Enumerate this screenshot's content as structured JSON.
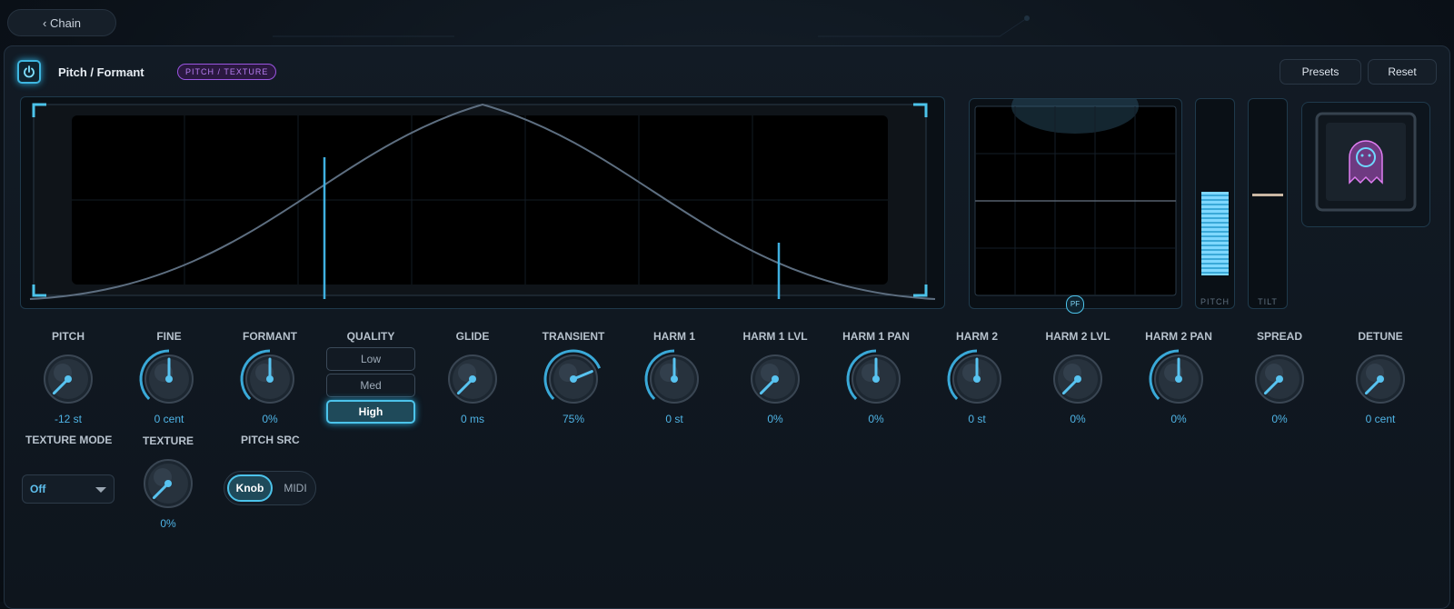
{
  "nav": {
    "back_label": "‹ Chain"
  },
  "module": {
    "title": "Pitch / Formant",
    "category": "PITCH / TEXTURE",
    "presets_label": "Presets",
    "reset_label": "Reset"
  },
  "display": {
    "pad_badge": "PF",
    "pitch_meter_label": "PITCH",
    "pitch_meter_level": 0.42,
    "tilt_meter_label": "TILT",
    "tilt_meter_position": 0.5
  },
  "controls_row1": [
    {
      "id": "pitch",
      "label": "PITCH",
      "value": "-12 st",
      "norm": 0.0
    },
    {
      "id": "fine",
      "label": "FINE",
      "value": "0 cent",
      "norm": 0.5
    },
    {
      "id": "formant",
      "label": "FORMANT",
      "value": "0%",
      "norm": 0.5
    },
    {
      "id": "glide",
      "label": "GLIDE",
      "value": "0 ms",
      "norm": 0.0
    },
    {
      "id": "transient",
      "label": "TRANSIENT",
      "value": "75%",
      "norm": 0.75
    },
    {
      "id": "harm1",
      "label": "HARM 1",
      "value": "0 st",
      "norm": 0.5
    },
    {
      "id": "harm1lvl",
      "label": "HARM 1 LVL",
      "value": "0%",
      "norm": 0.0
    },
    {
      "id": "harm1pan",
      "label": "HARM 1 PAN",
      "value": "0%",
      "norm": 0.5
    },
    {
      "id": "harm2",
      "label": "HARM 2",
      "value": "0 st",
      "norm": 0.5
    },
    {
      "id": "harm2lvl",
      "label": "HARM 2 LVL",
      "value": "0%",
      "norm": 0.0
    },
    {
      "id": "harm2pan",
      "label": "HARM 2 PAN",
      "value": "0%",
      "norm": 0.5
    },
    {
      "id": "spread",
      "label": "SPREAD",
      "value": "0%",
      "norm": 0.0
    },
    {
      "id": "detune",
      "label": "DETUNE",
      "value": "0 cent",
      "norm": 0.0
    }
  ],
  "quality": {
    "label": "QUALITY",
    "options": [
      "Low",
      "Med",
      "High"
    ],
    "selected": "High"
  },
  "texture_mode": {
    "label": "TEXTURE MODE",
    "value": "Off"
  },
  "texture": {
    "label": "TEXTURE",
    "value": "0%",
    "norm": 0.0
  },
  "pitch_src": {
    "label": "PITCH SRC",
    "options": [
      "Knob",
      "MIDI"
    ],
    "selected": "Knob"
  },
  "colors": {
    "accent": "#4cc3ea",
    "value_text": "#4fb4e6",
    "badge": "#9a55e0"
  }
}
